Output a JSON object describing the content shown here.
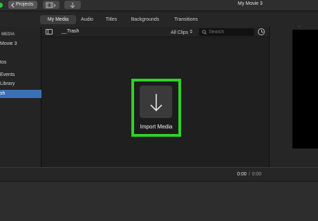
{
  "titlebar": {
    "projects_label": "Projects",
    "window_title": "My Movie 3"
  },
  "tabs": [
    {
      "label": "My Media",
      "active": true
    },
    {
      "label": "Audio",
      "active": false
    },
    {
      "label": "Titles",
      "active": false
    },
    {
      "label": "Backgrounds",
      "active": false
    },
    {
      "label": "Transitions",
      "active": false
    }
  ],
  "sidebar": {
    "header": "MEDIA",
    "items": [
      {
        "label": "Movie 3"
      },
      {
        "label": "tos"
      },
      {
        "label": "Events"
      },
      {
        "label": "Library"
      },
      {
        "label": "sh",
        "selected": true
      }
    ]
  },
  "browser": {
    "title": "__Trash",
    "clips_filter": "All Clips",
    "search_placeholder": "Search",
    "import_label": "Import Media"
  },
  "timeline": {
    "current_time": "0:00",
    "separator": "/",
    "total_time": "0:00"
  },
  "colors": {
    "accent_selected": "#3b6fb6",
    "highlight_box": "#2fd12a"
  }
}
